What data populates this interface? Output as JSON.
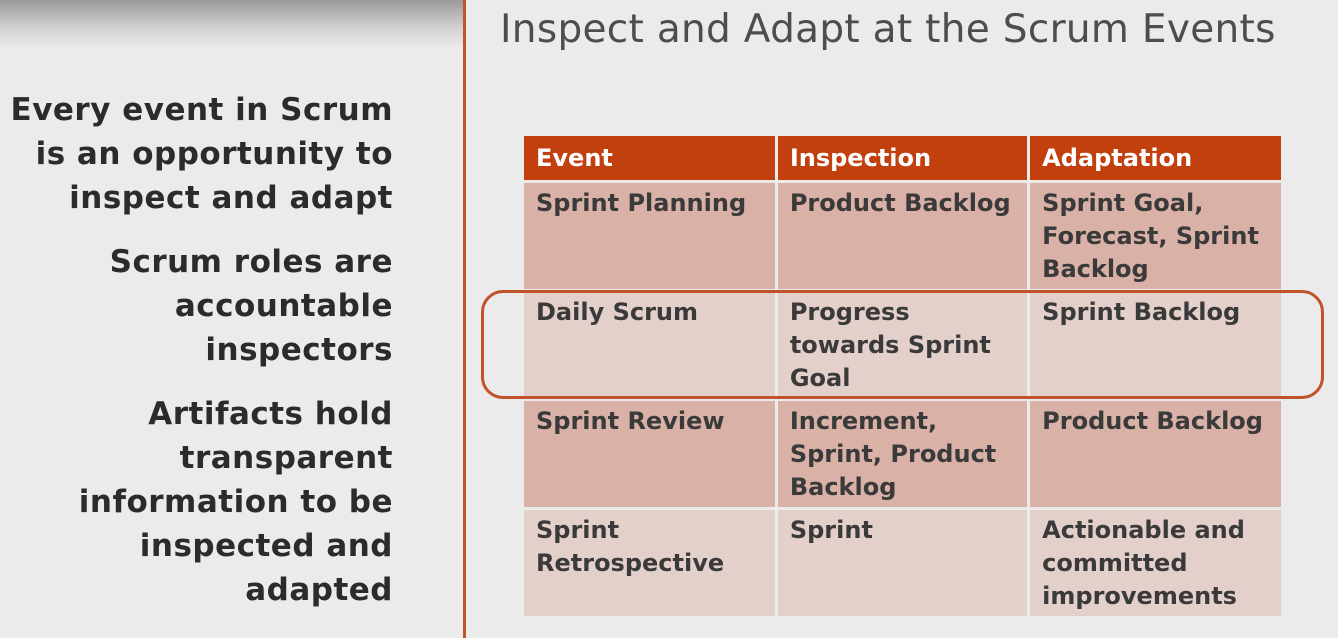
{
  "slide": {
    "title": "Inspect and Adapt at the Scrum Events"
  },
  "left_points": [
    "Every event in Scrum is an opportunity to inspect and adapt",
    "Scrum roles are accountable inspectors",
    "Artifacts hold transparent information to be inspected and adapted"
  ],
  "table": {
    "headers": [
      "Event",
      "Inspection",
      "Adaptation"
    ],
    "rows": [
      [
        "Sprint Planning",
        "Product Backlog",
        "Sprint Goal, Forecast, Sprint Backlog"
      ],
      [
        "Daily Scrum",
        "Progress towards Sprint Goal",
        "Sprint Backlog"
      ],
      [
        "Sprint Review",
        "Increment, Sprint, Product Backlog",
        "Product Backlog"
      ],
      [
        "Sprint Retrospective",
        "Sprint",
        "Actionable and committed improvements"
      ]
    ],
    "highlighted_row": "Daily Scrum"
  },
  "colors": {
    "accent": "#c0532a",
    "header_bg": "#c23f0e",
    "row_dark": "#d9b1a6",
    "row_light": "#e4d0ca",
    "background": "#ebebeb"
  }
}
